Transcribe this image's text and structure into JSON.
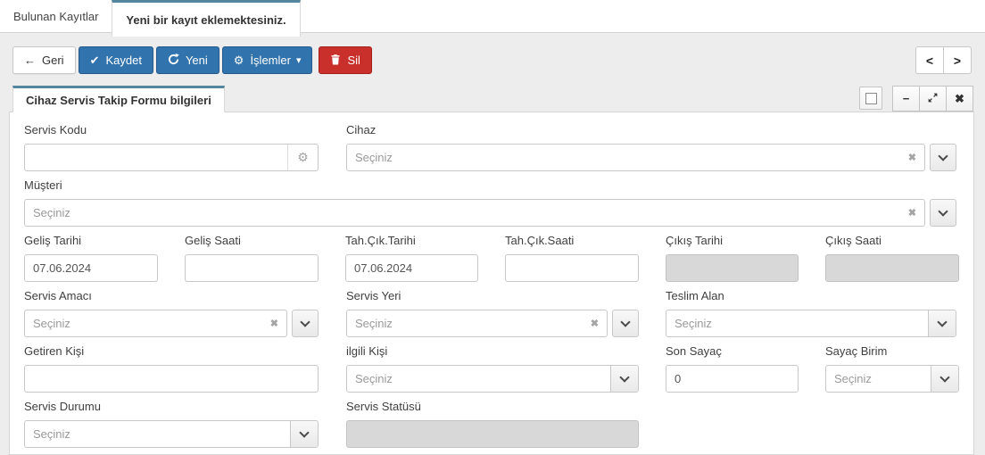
{
  "colors": {
    "accent": "#53869e",
    "primary": "#3173ac",
    "primary-border": "#27598a",
    "danger": "#c9302c",
    "danger-border": "#a5211e"
  },
  "page_tabs": {
    "found_records": "Bulunan Kayıtlar",
    "new_record": "Yeni bir kayıt eklemektesiniz."
  },
  "toolbar": {
    "back_label": "Geri",
    "save_label": "Kaydet",
    "new_label": "Yeni",
    "actions_label": "İşlemler",
    "delete_label": "Sil",
    "back_icon": "←",
    "save_icon": "✔",
    "actions_icon": "⚙",
    "caret_icon": "▾"
  },
  "pager": {
    "prev_icon": "<",
    "next_icon": ">"
  },
  "panel": {
    "title": "Cihaz Servis Takip Formu bilgileri",
    "minimize_icon": "−",
    "close_icon": "✖"
  },
  "form": {
    "servis_kodu": {
      "label": "Servis Kodu",
      "value": "",
      "gear_icon": "⚙"
    },
    "cihaz": {
      "label": "Cihaz",
      "placeholder": "Seçiniz",
      "clear_icon": "✖"
    },
    "musteri": {
      "label": "Müşteri",
      "placeholder": "Seçiniz",
      "clear_icon": "✖"
    },
    "gelis_tarihi": {
      "label": "Geliş Tarihi",
      "value": "07.06.2024"
    },
    "gelis_saati": {
      "label": "Geliş Saati",
      "value": ""
    },
    "tah_cik_tarihi": {
      "label": "Tah.Çık.Tarihi",
      "value": "07.06.2024"
    },
    "tah_cik_saati": {
      "label": "Tah.Çık.Saati",
      "value": ""
    },
    "cikis_tarihi": {
      "label": "Çıkış Tarihi",
      "value": "",
      "disabled": true
    },
    "cikis_saati": {
      "label": "Çıkış Saati",
      "value": "",
      "disabled": true
    },
    "servis_amaci": {
      "label": "Servis Amacı",
      "placeholder": "Seçiniz",
      "clear_icon": "✖"
    },
    "servis_yeri": {
      "label": "Servis Yeri",
      "placeholder": "Seçiniz",
      "clear_icon": "✖"
    },
    "teslim_alan": {
      "label": "Teslim Alan",
      "placeholder": "Seçiniz"
    },
    "getiren_kisi": {
      "label": "Getiren Kişi",
      "value": ""
    },
    "ilgili_kisi": {
      "label": "ilgili Kişi",
      "placeholder": "Seçiniz"
    },
    "son_sayac": {
      "label": "Son Sayaç",
      "value": "0"
    },
    "sayac_birim": {
      "label": "Sayaç Birim",
      "placeholder": "Seçiniz"
    },
    "servis_durumu": {
      "label": "Servis Durumu",
      "placeholder": "Seçiniz"
    },
    "servis_statusu": {
      "label": "Servis Statüsü",
      "value": "",
      "disabled": true
    }
  }
}
